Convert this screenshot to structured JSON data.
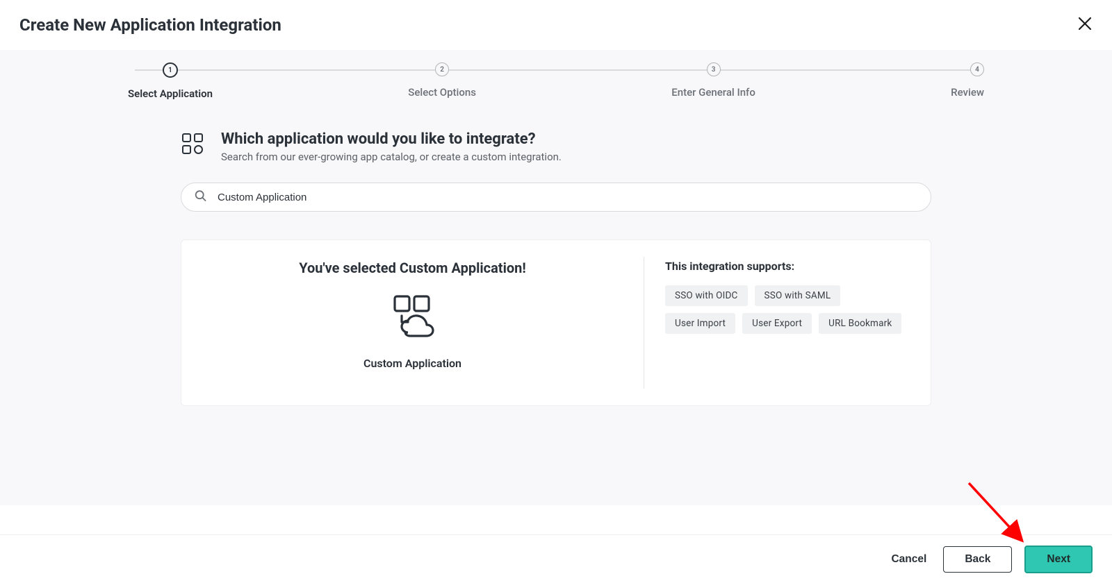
{
  "header": {
    "title": "Create New Application Integration"
  },
  "stepper": {
    "steps": [
      {
        "num": "1",
        "label": "Select Application",
        "active": true
      },
      {
        "num": "2",
        "label": "Select Options",
        "active": false
      },
      {
        "num": "3",
        "label": "Enter General Info",
        "active": false
      },
      {
        "num": "4",
        "label": "Review",
        "active": false
      }
    ]
  },
  "question": {
    "heading": "Which application would you like to integrate?",
    "subheading": "Search from our ever-growing app catalog, or create a custom integration."
  },
  "search": {
    "value": "Custom Application"
  },
  "selection": {
    "heading": "You've selected Custom Application!",
    "app_name": "Custom Application",
    "supports_heading": "This integration supports:",
    "chips": [
      "SSO with OIDC",
      "SSO with SAML",
      "User Import",
      "User Export",
      "URL Bookmark"
    ]
  },
  "footer": {
    "cancel": "Cancel",
    "back": "Back",
    "next": "Next"
  }
}
